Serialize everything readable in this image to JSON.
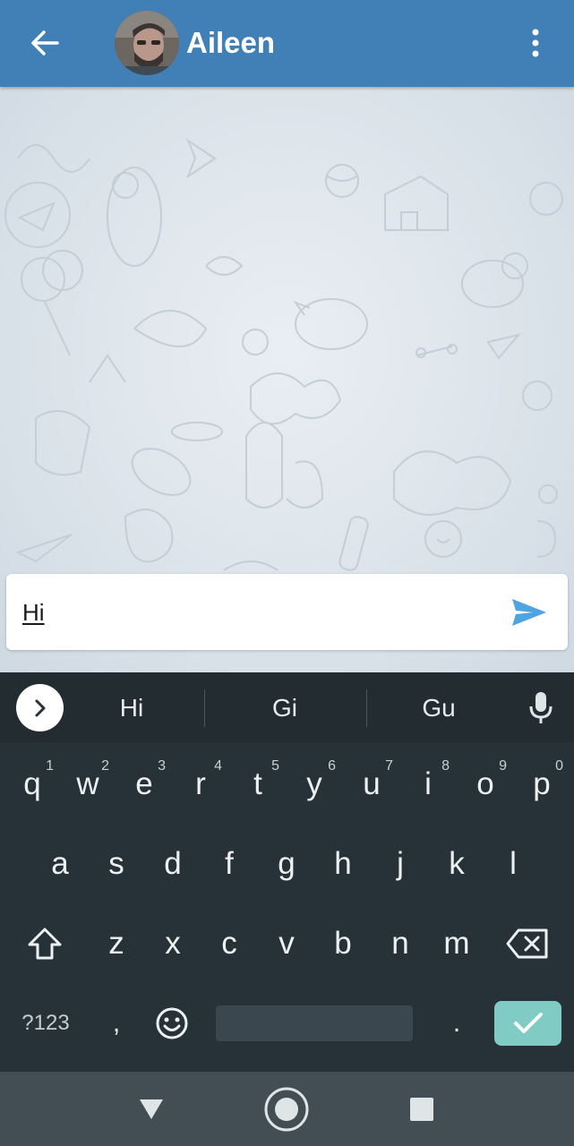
{
  "header": {
    "contact_name": "Aileen",
    "back_icon": "arrow-left-icon",
    "menu_icon": "more-vertical-icon",
    "bar_color": "#4080b6"
  },
  "composer": {
    "text": "Hi",
    "send_icon": "send-icon",
    "send_color": "#4ea4e3"
  },
  "keyboard": {
    "suggestions": [
      "Hi",
      "Gi",
      "Gu"
    ],
    "expand_icon": "chevron-right-icon",
    "mic_icon": "microphone-icon",
    "row1": [
      {
        "ch": "q",
        "hint": "1"
      },
      {
        "ch": "w",
        "hint": "2"
      },
      {
        "ch": "e",
        "hint": "3"
      },
      {
        "ch": "r",
        "hint": "4"
      },
      {
        "ch": "t",
        "hint": "5"
      },
      {
        "ch": "y",
        "hint": "6"
      },
      {
        "ch": "u",
        "hint": "7"
      },
      {
        "ch": "i",
        "hint": "8"
      },
      {
        "ch": "o",
        "hint": "9"
      },
      {
        "ch": "p",
        "hint": "0"
      }
    ],
    "row2": [
      "a",
      "s",
      "d",
      "f",
      "g",
      "h",
      "j",
      "k",
      "l"
    ],
    "row3": [
      "z",
      "x",
      "c",
      "v",
      "b",
      "n",
      "m"
    ],
    "symbols_label": "?123",
    "comma": ",",
    "period": ".",
    "shift_icon": "shift-icon",
    "backspace_icon": "backspace-icon",
    "emoji_icon": "emoji-icon",
    "enter_icon": "check-icon",
    "enter_color": "#80cbc4"
  },
  "navbar": {
    "back_icon": "triangle-back-icon",
    "home_icon": "circle-home-icon",
    "recents_icon": "square-recents-icon"
  }
}
